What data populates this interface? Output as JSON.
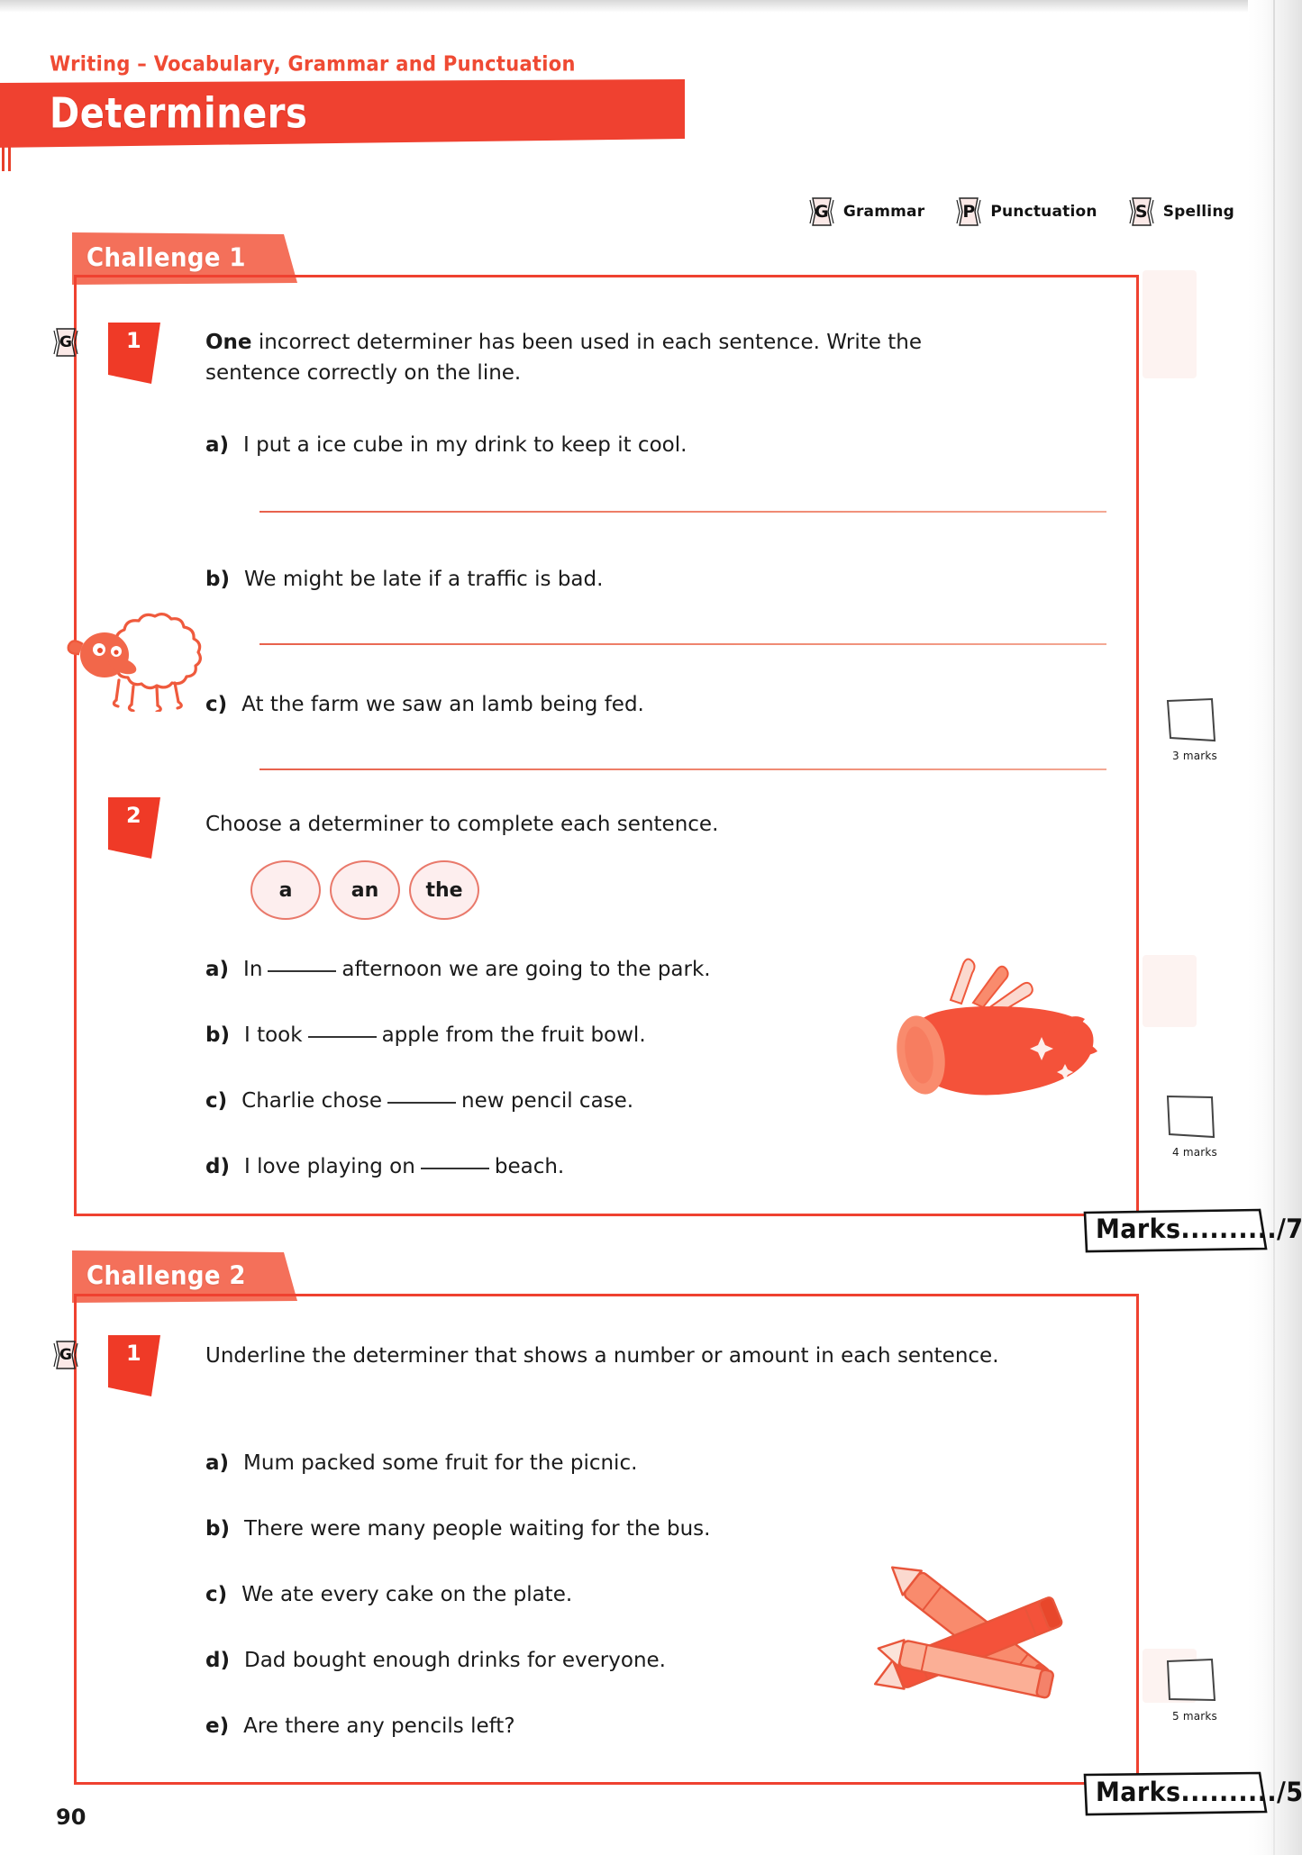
{
  "page": {
    "subject_line": "Writing – Vocabulary, Grammar and Punctuation",
    "title": "Determiners",
    "page_number": "90",
    "accent_red": "#ef4130",
    "tab_coral": "#f4705a",
    "oval_pink": "#fdeeee"
  },
  "legend": {
    "items": [
      {
        "code": "G",
        "label": "Grammar",
        "icon": "grammar-badge-icon"
      },
      {
        "code": "P",
        "label": "Punctuation",
        "icon": "punctuation-badge-icon"
      },
      {
        "code": "S",
        "label": "Spelling",
        "icon": "spelling-badge-icon"
      }
    ]
  },
  "challenges": [
    {
      "tab_label": "Challenge 1",
      "marks_total_label": "Marks..........",
      "marks_total_value": "/7",
      "questions": [
        {
          "badge_code": "G",
          "number": "1",
          "prompt_bold": "One",
          "prompt_rest": " incorrect determiner has been used in each sentence. Write the sentence correctly on the line.",
          "marks_label": "3 marks",
          "items": [
            {
              "letter": "a)",
              "text": "I put a ice cube in my drink to keep it cool."
            },
            {
              "letter": "b)",
              "text": "We might be late if a traffic is bad."
            },
            {
              "letter": "c)",
              "text": "At the farm we saw an lamb being fed."
            }
          ]
        },
        {
          "badge_code": "",
          "number": "2",
          "prompt_bold": "",
          "prompt_rest": "Choose a determiner to complete each sentence.",
          "marks_label": "4 marks",
          "word_bank": [
            "a",
            "an",
            "the"
          ],
          "items": [
            {
              "letter": "a)",
              "pre": "In",
              "post": "afternoon we are going to the park."
            },
            {
              "letter": "b)",
              "pre": "I took",
              "post": "apple from the fruit bowl."
            },
            {
              "letter": "c)",
              "pre": "Charlie chose",
              "post": "new pencil case."
            },
            {
              "letter": "d)",
              "pre": "I love playing on",
              "post": "beach."
            }
          ]
        }
      ]
    },
    {
      "tab_label": "Challenge 2",
      "marks_total_label": "Marks..........",
      "marks_total_value": "/5",
      "questions": [
        {
          "badge_code": "G",
          "number": "1",
          "prompt_bold": "",
          "prompt_rest": "Underline the determiner that shows a number or amount in each sentence.",
          "marks_label": "5 marks",
          "items": [
            {
              "letter": "a)",
              "text": "Mum packed some fruit for the picnic."
            },
            {
              "letter": "b)",
              "text": "There were many people waiting for the bus."
            },
            {
              "letter": "c)",
              "text": "We ate every cake on the plate."
            },
            {
              "letter": "d)",
              "text": "Dad bought enough drinks for everyone."
            },
            {
              "letter": "e)",
              "text": "Are there any pencils left?"
            }
          ]
        }
      ]
    }
  ],
  "illustrations": [
    {
      "name": "sheep-illustration"
    },
    {
      "name": "pencil-case-illustration"
    },
    {
      "name": "crayons-illustration"
    }
  ]
}
